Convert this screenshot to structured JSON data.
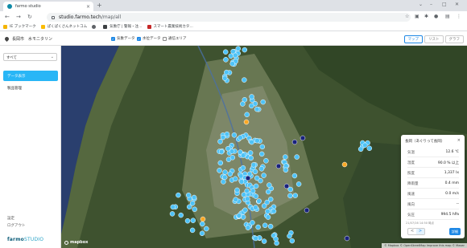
{
  "browser": {
    "tab_title": "farmo studio",
    "url_host": "studio.farmo.tech",
    "url_path": "/map/all",
    "bookmarks": [
      {
        "label": "IE ブックマーク",
        "color": "#f4b400"
      },
      {
        "label": "ぱくぱくさんネットコム",
        "color": "#fbbc04"
      },
      {
        "label": "",
        "color": "#5f6368"
      },
      {
        "label": "気象庁 | 警報・注…",
        "color": "#3c4043"
      },
      {
        "label": "スマート農業技術カタ…",
        "color": "#c62828"
      }
    ]
  },
  "header": {
    "location": "長岡市　水モニタリン",
    "filters": [
      {
        "label": "気象データ",
        "checked": true
      },
      {
        "label": "水位データ",
        "checked": true
      },
      {
        "label": "通信エリア",
        "checked": false
      }
    ],
    "view_tabs": [
      {
        "label": "マップ",
        "active": true
      },
      {
        "label": "リスト",
        "active": false
      },
      {
        "label": "グラフ",
        "active": false
      }
    ]
  },
  "sidebar": {
    "select_value": "すべて",
    "items": [
      {
        "label": "データ表示",
        "active": true
      },
      {
        "label": "製品管理",
        "active": false
      }
    ],
    "footer": [
      "設定",
      "ログアウト"
    ],
    "brand_bold": "farmo",
    "brand_thin": "STUDIO"
  },
  "map": {
    "logo": "mapbox",
    "attribution": "© Mapbox © OpenStreetMap  Improve this map © Maxar",
    "marker_colors": {
      "water": "#4fc3f7",
      "weather": "#1a237e",
      "alert": "#f9a825"
    }
  },
  "popup": {
    "title": "長岡（あぐりって長岡）",
    "close": "×",
    "rows": [
      {
        "label": "気温",
        "value": "12.6 ℃"
      },
      {
        "label": "湿度",
        "value": "90.0 % 以上"
      },
      {
        "label": "照度",
        "value": "1,337 lx"
      },
      {
        "label": "降雨量",
        "value": "0.4 mm"
      },
      {
        "label": "風速",
        "value": "0.0 m/s"
      },
      {
        "label": "風向",
        "value": "--"
      },
      {
        "label": "気圧",
        "value": "994.5 hPa"
      }
    ],
    "timestamp": "21/07/16 14:50 時点",
    "pager": [
      "<",
      ">"
    ],
    "detail_label": "詳細"
  }
}
